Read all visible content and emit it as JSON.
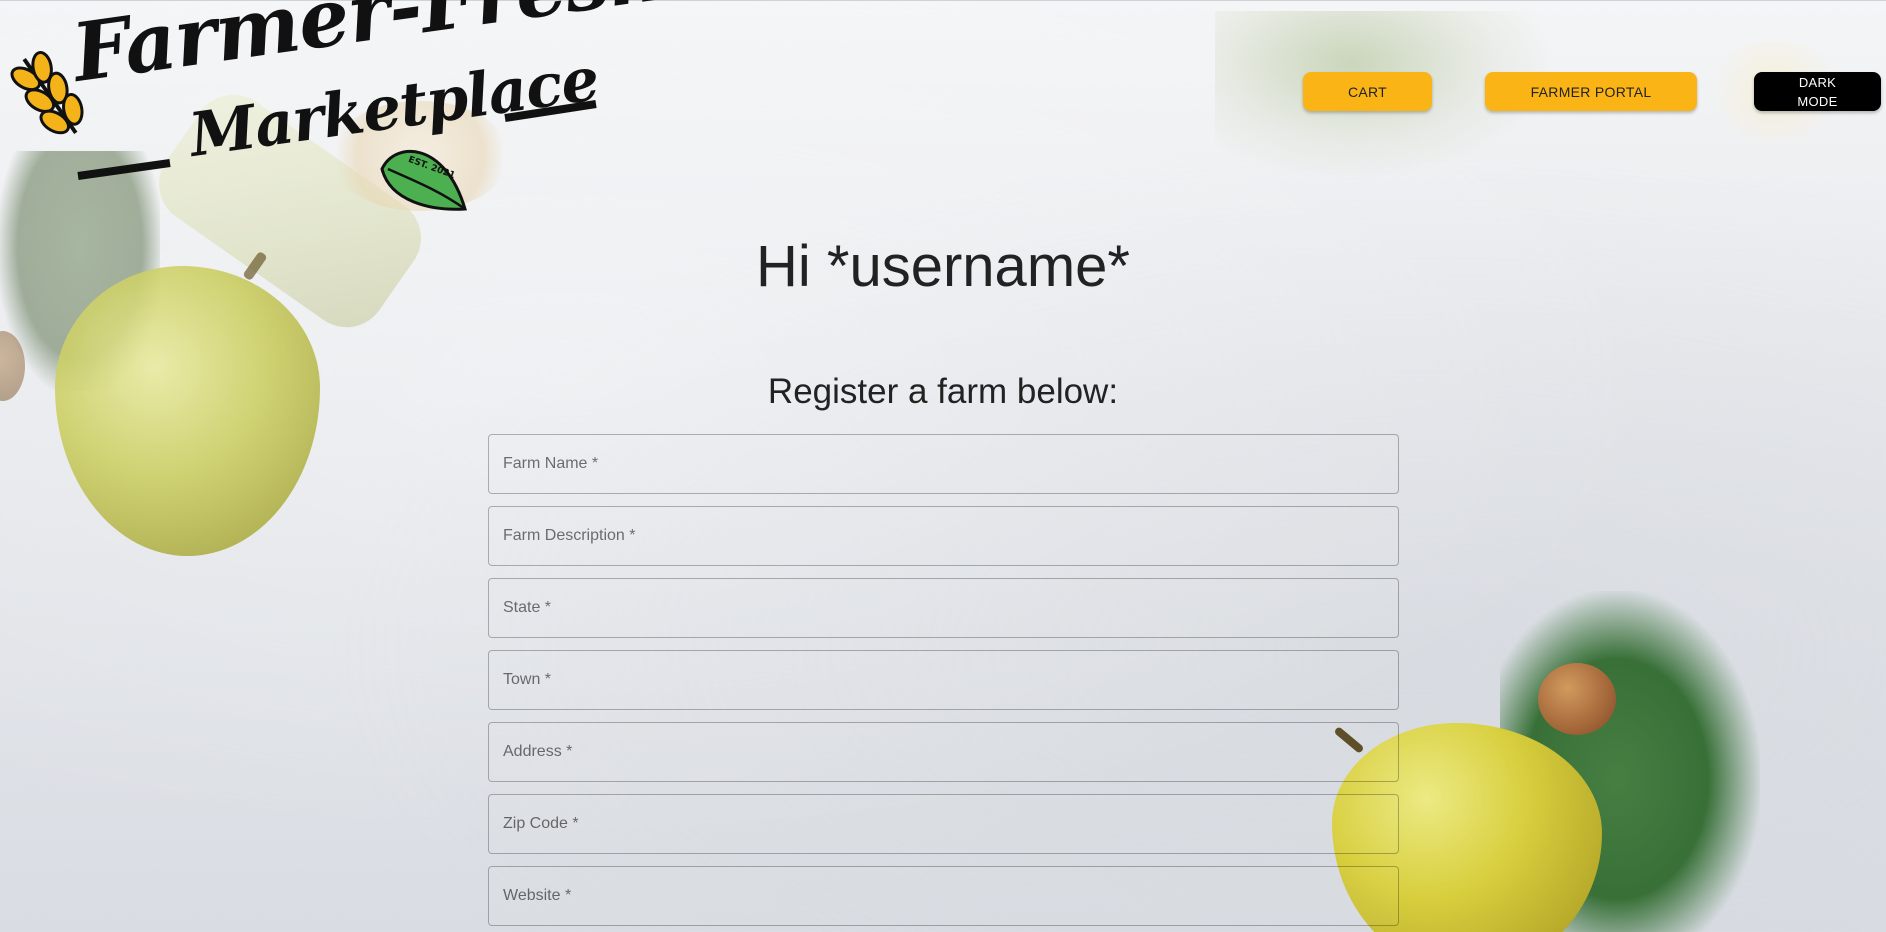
{
  "logo": {
    "line1": "Farmer-Fresh",
    "line2": "Marketplace",
    "est": "EST. 2021"
  },
  "header": {
    "cart_label": "CART",
    "portal_label": "FARMER PORTAL",
    "dark_mode_label": "DARK MODE"
  },
  "main": {
    "greeting": "Hi *username*",
    "subtitle": "Register a farm below:",
    "fields": [
      {
        "placeholder": "Farm Name *"
      },
      {
        "placeholder": "Farm Description *"
      },
      {
        "placeholder": "State *"
      },
      {
        "placeholder": "Town *"
      },
      {
        "placeholder": "Address *"
      },
      {
        "placeholder": "Zip Code *"
      },
      {
        "placeholder": "Website *"
      }
    ]
  },
  "colors": {
    "accent": "#fbb416",
    "dark_button": "#000000",
    "leaf": "#4caf50"
  },
  "icons": [
    "wheat-icon",
    "leaf-icon"
  ]
}
